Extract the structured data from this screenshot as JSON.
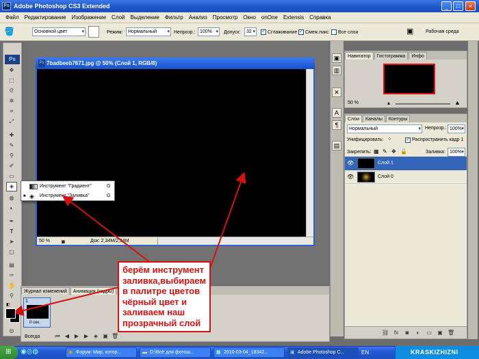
{
  "app": {
    "title": "Adobe Photoshop CS3 Extended"
  },
  "menu": [
    "Файл",
    "Редактирование",
    "Изображение",
    "Слой",
    "Выделение",
    "Фильтр",
    "Анализ",
    "Просмотр",
    "Окно",
    "onOne",
    "Extensis",
    "Справка"
  ],
  "options": {
    "fill_source": "Основной цвет",
    "mode_label": "Режим:",
    "mode_value": "Нормальный",
    "opacity_label": "Непрозр.:",
    "opacity_value": "100%",
    "tolerance_label": "Допуск:",
    "tolerance_value": "32",
    "antialias_label": "Сглаживание",
    "contiguous_label": "Смеж.пикс",
    "all_layers_label": "Все слои",
    "workspace_label": "Рабочая среда"
  },
  "document": {
    "title": "7badbeeb7671.jpg @ 50% (Слой 1, RGB/8)",
    "zoom": "50 %",
    "doc_size": "Док: 2,34M/2,34M"
  },
  "flyout": {
    "items": [
      {
        "label": "Инструмент \"Градиент\"",
        "key": "G"
      },
      {
        "label": "Инструмент \"Заливка\"",
        "key": "G"
      }
    ]
  },
  "navigator": {
    "tabs": [
      "Навигатор",
      "Гистограмма",
      "Инфо"
    ],
    "zoom": "50 %"
  },
  "layers": {
    "tabs": [
      "Слои",
      "Каналы",
      "Контуры"
    ],
    "blend_mode": "Нормальный",
    "opacity_label": "Непрозр.:",
    "opacity_value": "100%",
    "unify_label": "Унифицировать:",
    "propagate_label": "Распространить кадр 1",
    "lock_label": "Закрепить:",
    "fill_label": "Заливка:",
    "fill_value": "100%",
    "items": [
      {
        "name": "Слой 1",
        "selected": true
      },
      {
        "name": "Слой 0",
        "selected": false
      }
    ]
  },
  "history": {
    "tabs": [
      "Журнал изменений",
      "Анимация (кадры)"
    ],
    "frame_number": "1",
    "frame_delay": "0 сек.",
    "loop": "Всегда"
  },
  "annotation": {
    "text": "берём инструмент заливка,выбираем в палитре цветов чёрный цвет и заливаем наш прозрачный слой",
    "color": "#d81010"
  },
  "taskbar": {
    "items": [
      "Форум: Мир, котор...",
      "D:\\Всё для фотош...",
      "2010-03-04_18342...",
      "Adobe Photoshop C..."
    ],
    "lang": "EN",
    "watermark": "KRASKIZHIZNI"
  },
  "colors": {
    "accent": "#2d62d3",
    "selected_layer": "#3366b8",
    "annotation": "#d81010"
  }
}
